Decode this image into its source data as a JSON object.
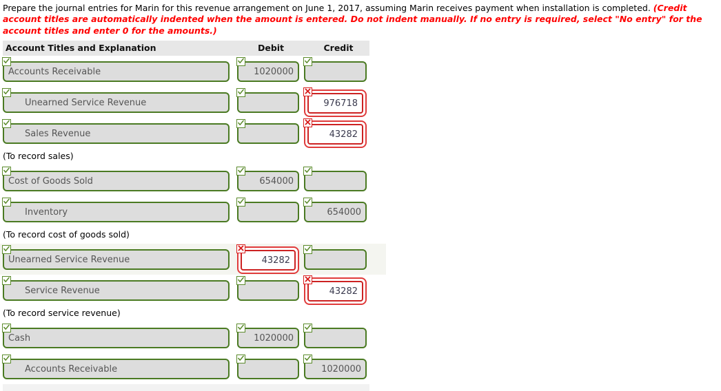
{
  "prompt": {
    "lead": "Prepare the journal entries for Marin for this revenue arrangement on June 1, 2017, assuming Marin receives payment when installation is completed. ",
    "note": "(Credit account titles are automatically indented when the amount is entered. Do not indent manually. If no entry is required, select \"No entry\" for the account titles and enter 0 for the amounts.)"
  },
  "table": {
    "headers": {
      "account": "Account Titles and Explanation",
      "debit": "Debit",
      "credit": "Credit"
    },
    "rows": [
      {
        "kind": "entry",
        "indent": false,
        "alt": false,
        "account": {
          "value": "Accounts Receivable",
          "status": "correct"
        },
        "debit": {
          "value": "1020000",
          "status": "correct"
        },
        "credit": {
          "value": "",
          "status": "correct"
        }
      },
      {
        "kind": "entry",
        "indent": true,
        "alt": false,
        "account": {
          "value": "Unearned Service Revenue",
          "status": "correct"
        },
        "debit": {
          "value": "",
          "status": "correct"
        },
        "credit": {
          "value": "976718",
          "status": "incorrect"
        }
      },
      {
        "kind": "entry",
        "indent": true,
        "alt": false,
        "account": {
          "value": "Sales Revenue",
          "status": "correct"
        },
        "debit": {
          "value": "",
          "status": "correct"
        },
        "credit": {
          "value": "43282",
          "status": "incorrect"
        }
      },
      {
        "kind": "caption",
        "text": "(To record sales)"
      },
      {
        "kind": "entry",
        "indent": false,
        "alt": false,
        "account": {
          "value": "Cost of Goods Sold",
          "status": "correct"
        },
        "debit": {
          "value": "654000",
          "status": "correct"
        },
        "credit": {
          "value": "",
          "status": "correct"
        }
      },
      {
        "kind": "entry",
        "indent": true,
        "alt": false,
        "account": {
          "value": "Inventory",
          "status": "correct"
        },
        "debit": {
          "value": "",
          "status": "correct"
        },
        "credit": {
          "value": "654000",
          "status": "correct"
        }
      },
      {
        "kind": "caption",
        "text": "(To record cost of goods sold)"
      },
      {
        "kind": "entry",
        "indent": false,
        "alt": true,
        "account": {
          "value": "Unearned Service Revenue",
          "status": "correct"
        },
        "debit": {
          "value": "43282",
          "status": "incorrect"
        },
        "credit": {
          "value": "",
          "status": "correct"
        }
      },
      {
        "kind": "entry",
        "indent": true,
        "alt": false,
        "account": {
          "value": "Service Revenue",
          "status": "correct"
        },
        "debit": {
          "value": "",
          "status": "correct"
        },
        "credit": {
          "value": "43282",
          "status": "incorrect"
        }
      },
      {
        "kind": "caption",
        "text": "(To record service revenue)"
      },
      {
        "kind": "entry",
        "indent": false,
        "alt": false,
        "account": {
          "value": "Cash",
          "status": "correct"
        },
        "debit": {
          "value": "1020000",
          "status": "correct"
        },
        "credit": {
          "value": "",
          "status": "correct"
        }
      },
      {
        "kind": "entry",
        "indent": true,
        "alt": false,
        "account": {
          "value": "Accounts Receivable",
          "status": "correct"
        },
        "debit": {
          "value": "",
          "status": "correct"
        },
        "credit": {
          "value": "1020000",
          "status": "correct"
        }
      }
    ]
  },
  "icons": {
    "correct": "check-icon",
    "incorrect": "cross-icon"
  },
  "colors": {
    "correct_border": "#4a7a22",
    "incorrect_border": "#cc2222",
    "field_fill": "#dddddd",
    "header_fill": "#e7e7e7",
    "note_text": "#ff0000"
  }
}
